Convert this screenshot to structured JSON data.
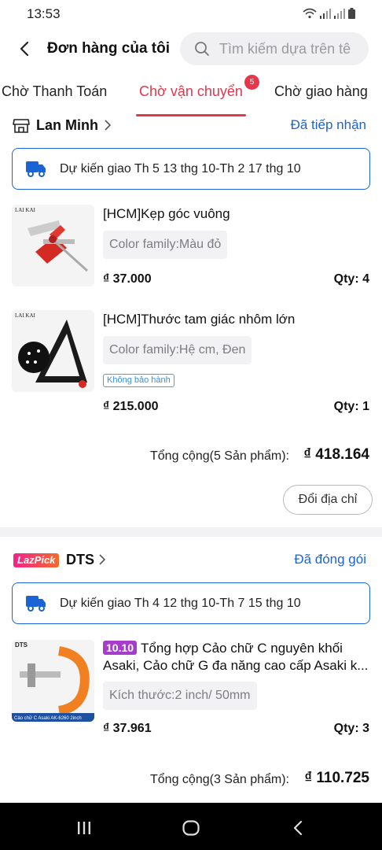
{
  "status_bar": {
    "time": "13:53"
  },
  "header": {
    "title": "Đơn hàng của tôi",
    "search_placeholder": "Tìm kiếm dựa trên tê"
  },
  "tabs": [
    {
      "label": "Chờ Thanh Toán",
      "active": false
    },
    {
      "label": "Chờ vận chuyển",
      "active": true,
      "badge": "5"
    },
    {
      "label": "Chờ giao hàng",
      "active": false
    }
  ],
  "orders": [
    {
      "store": "Lan Minh",
      "status": "Đã tiếp nhận",
      "delivery": "Dự kiến giao Th 5 13 thg 10-Th 2 17 thg 10",
      "items": [
        {
          "title": "[HCM]Kẹp góc vuông",
          "variant": "Color family:Màu đỏ",
          "price": "₫ 37.000",
          "qty": "Qty: 4"
        },
        {
          "title": "[HCM]Thước tam giác nhôm lớn",
          "variant": "Color family:Hệ cm, Đen",
          "warranty": "Không bảo hành",
          "price": "₫ 215.000",
          "qty": "Qty: 1"
        }
      ],
      "total_label": "Tổng cộng(5 Sản phẩm):",
      "total_value": "₫ 418.164",
      "action_button": "Đổi địa chỉ"
    },
    {
      "store_tag": "LazPick",
      "store": "DTS",
      "status": "Đã đóng gói",
      "delivery": "Dự kiến giao Th 4 12 thg 10-Th 7 15 thg 10",
      "items": [
        {
          "campaign_tag": "10.10",
          "title_line1": "Tổng hợp Cảo chữ C nguyên khối",
          "title_line2": "Asaki, Cảo chữ G đa năng cao cấp Asaki k...",
          "variant": "Kích thước:2 inch/ 50mm",
          "price": "₫ 37.961",
          "qty": "Qty: 3"
        }
      ],
      "total_label": "Tổng cộng(3 Sản phẩm):",
      "total_value": "₫ 110.725"
    }
  ],
  "thumb_text": {
    "brand1": "LAI KAI",
    "brand2": "LAI KAI",
    "brand3": "DTS",
    "caption3": "Cảo chữ C Asaki AK-6260 2inch"
  },
  "colors": {
    "accent": "#e5364c",
    "link": "#1a64d6",
    "campaign": "#a63ccc"
  }
}
